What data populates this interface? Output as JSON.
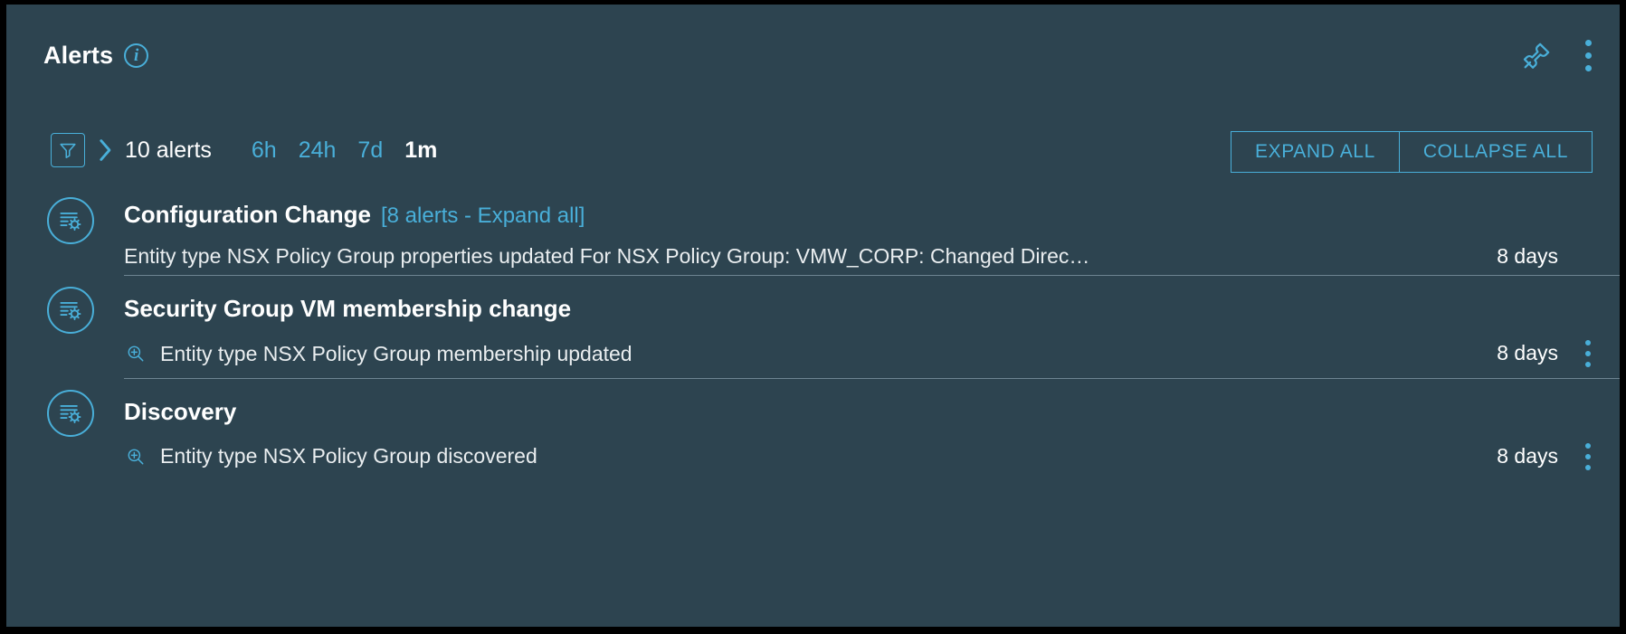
{
  "header": {
    "title": "Alerts",
    "info_icon": "info-icon",
    "pin_icon": "pin-icon",
    "menu_icon": "kebab-menu-icon"
  },
  "toolbar": {
    "filter_icon": "filter-icon",
    "expand_chevron_icon": "chevron-right-icon",
    "alert_count": "10 alerts",
    "ranges": [
      {
        "label": "6h",
        "active": false
      },
      {
        "label": "24h",
        "active": false
      },
      {
        "label": "7d",
        "active": false
      },
      {
        "label": "1m",
        "active": true
      }
    ],
    "expand_all": "EXPAND ALL",
    "collapse_all": "COLLAPSE ALL"
  },
  "groups": [
    {
      "icon": "configuration-gear-icon",
      "title": "Configuration Change",
      "expand_label": "[8 alerts - Expand all]",
      "rows": [
        {
          "zoom_icon": "",
          "text": "Entity type NSX Policy Group properties updated For NSX Policy Group: VMW_CORP: Changed Direc…",
          "age": "8 days",
          "menu": false
        }
      ]
    },
    {
      "icon": "configuration-gear-icon",
      "title": "Security Group VM membership change",
      "expand_label": "",
      "rows": [
        {
          "zoom_icon": "zoom-in-icon",
          "text": "Entity type NSX Policy Group membership updated",
          "age": "8 days",
          "menu": true
        }
      ]
    },
    {
      "icon": "configuration-gear-icon",
      "title": "Discovery",
      "expand_label": "",
      "rows": [
        {
          "zoom_icon": "zoom-in-icon",
          "text": "Entity type NSX Policy Group discovered",
          "age": "8 days",
          "menu": true
        }
      ]
    }
  ],
  "colors": {
    "card_bg": "#2d4450",
    "accent": "#49afd9",
    "text": "#ffffff",
    "divider": "#6d8491"
  }
}
